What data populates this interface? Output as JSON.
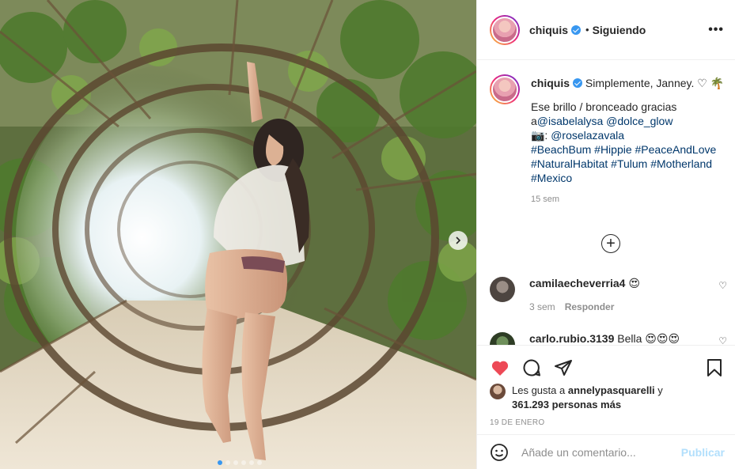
{
  "post": {
    "username": "chiquis",
    "dot": "•",
    "follow_status": "Siguiendo",
    "more": "•••",
    "caption": {
      "first_line": "Simplemente, Janney. ♡ 🌴",
      "line2": "Ese brillo / bronceado gracias",
      "prefix_a": "a",
      "mention1": "@isabelalysa",
      "mention2": "@dolce_glow",
      "camera": "📷: ",
      "mention3": "@roselazavala",
      "tags_line1": "#BeachBum #Hippie #PeaceAndLove",
      "tags_line2": "#NaturalHabitat #Tulum #Motherland",
      "tags_line3": "#Mexico",
      "time": "15 sem"
    },
    "load_more": "+",
    "comments": [
      {
        "user": "camilaecheverria4",
        "text": "😍",
        "time": "3 sem",
        "reply": "Responder"
      },
      {
        "user": "carlo.rubio.3139",
        "text": "Bella 😍😍😍",
        "time": "",
        "reply": ""
      }
    ],
    "likes": {
      "prefix": "Les gusta a",
      "user": "annelypasquarelli",
      "conj": "y",
      "count": "361.293",
      "suffix": "personas más"
    },
    "date": "19 DE ENERO",
    "add_comment": {
      "placeholder": "Añade un comentario...",
      "publish": "Publicar"
    },
    "carousel": {
      "dots": 6,
      "active": 0
    }
  },
  "colors": {
    "heart": "#ed4956",
    "link": "#00376b",
    "publish_disabled": "#b2dffc",
    "verified": "#3897f0"
  }
}
